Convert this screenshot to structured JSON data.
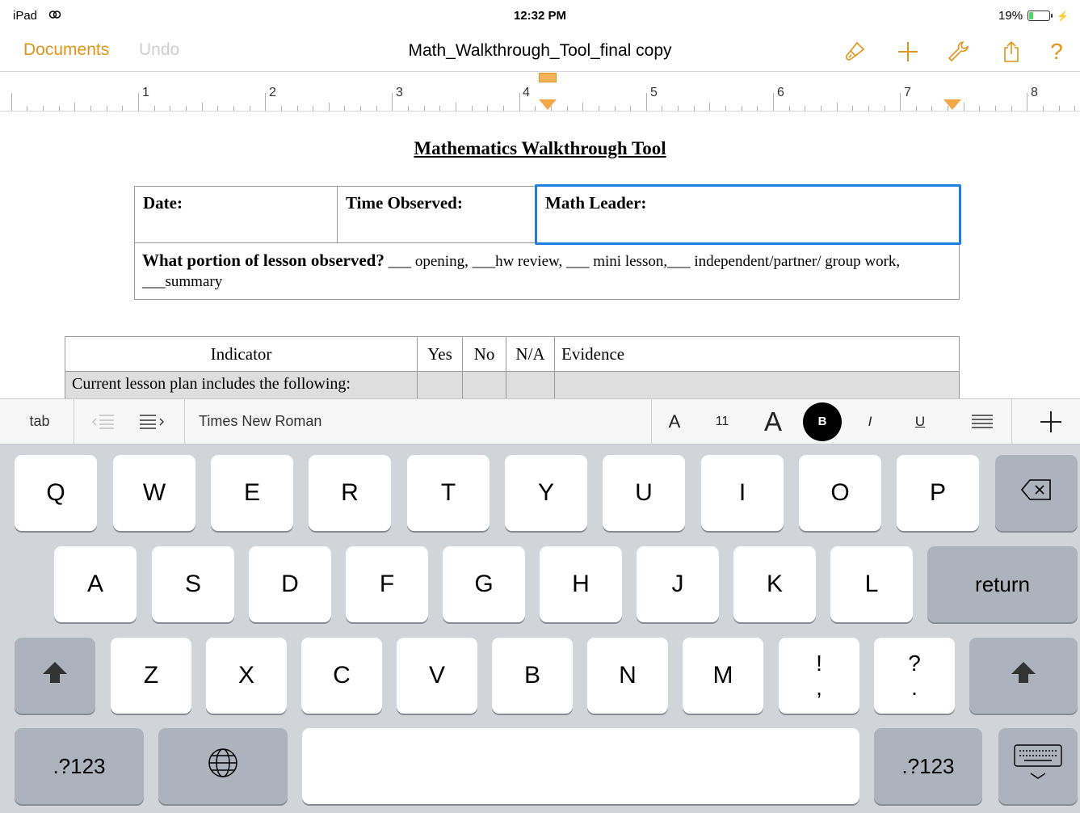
{
  "status_bar": {
    "device": "iPad",
    "time": "12:32 PM",
    "battery_label": "19%",
    "battery_level": 0.19
  },
  "nav": {
    "documents": "Documents",
    "undo": "Undo",
    "title": "Math_Walkthrough_Tool_final copy",
    "icons": [
      "paintbrush-icon",
      "plus-icon",
      "wrench-icon",
      "share-icon",
      "help-icon"
    ],
    "accent_color": "#e0951a"
  },
  "ruler": {
    "numbers": [
      "1",
      "2",
      "3",
      "4",
      "5",
      "6",
      "7",
      "8"
    ]
  },
  "document": {
    "heading": "Mathematics Walkthrough Tool",
    "header_table": {
      "date": "Date:",
      "time_observed": "Time Observed:",
      "math_leader": "Math Leader:",
      "portion_question": "What portion of lesson observed?",
      "portion_options": " ___ opening, ___hw review, ___ mini lesson,___ independent/partner/ group work, ___summary"
    },
    "indicator_table": {
      "headers": [
        "Indicator",
        "Yes",
        "No",
        "N/A",
        "Evidence"
      ],
      "row1": "Current lesson plan includes the following:"
    }
  },
  "format_bar": {
    "tab": "tab",
    "font_name": "Times New Roman",
    "font_smaller": "A",
    "font_size": "11",
    "font_larger": "A",
    "bold": "B",
    "italic": "I",
    "underline": "U"
  },
  "keyboard": {
    "row1": [
      "Q",
      "W",
      "E",
      "R",
      "T",
      "Y",
      "U",
      "I",
      "O",
      "P"
    ],
    "row2": [
      "A",
      "S",
      "D",
      "F",
      "G",
      "H",
      "J",
      "K",
      "L"
    ],
    "row3": [
      "Z",
      "X",
      "C",
      "V",
      "B",
      "N",
      "M"
    ],
    "punct1": {
      "top": "!",
      "bottom": ","
    },
    "punct2": {
      "top": "?",
      "bottom": "."
    },
    "return": "return",
    "numbers_left": ".?123",
    "numbers_right": ".?123"
  }
}
